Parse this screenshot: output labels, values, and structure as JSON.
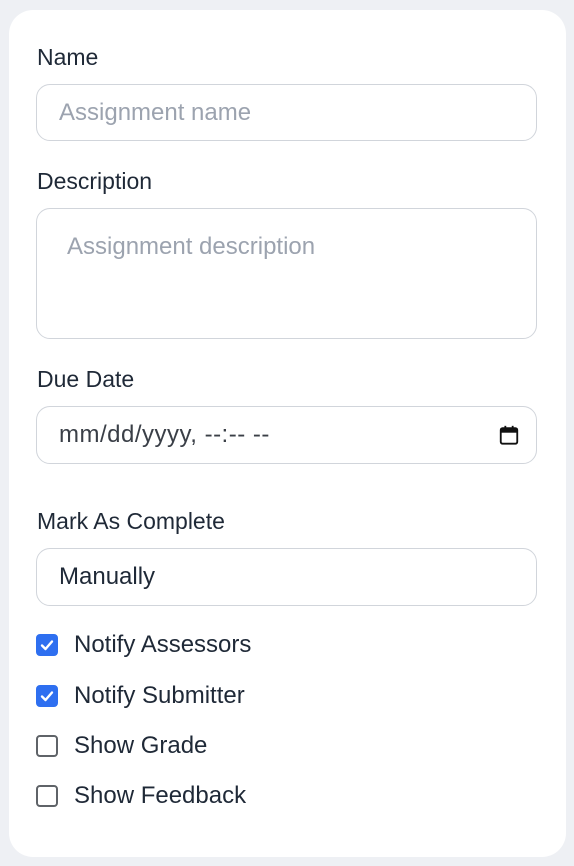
{
  "form": {
    "name": {
      "label": "Name",
      "placeholder": "Assignment name",
      "value": ""
    },
    "description": {
      "label": "Description",
      "placeholder": "Assignment description",
      "value": ""
    },
    "due_date": {
      "label": "Due Date",
      "value": "mm/dd/yyyy, --:-- --",
      "icon": "calendar-icon"
    },
    "mark_as_complete": {
      "label": "Mark As Complete",
      "selected": "Manually"
    },
    "options": [
      {
        "label": "Notify Assessors",
        "checked": true
      },
      {
        "label": "Notify Submitter",
        "checked": true
      },
      {
        "label": "Show Grade",
        "checked": false
      },
      {
        "label": "Show Feedback",
        "checked": false
      }
    ]
  },
  "colors": {
    "accent": "#2e6ff0",
    "background": "#eef0f4",
    "card": "#ffffff",
    "border": "#d1d5db",
    "placeholder": "#9ca3af"
  }
}
